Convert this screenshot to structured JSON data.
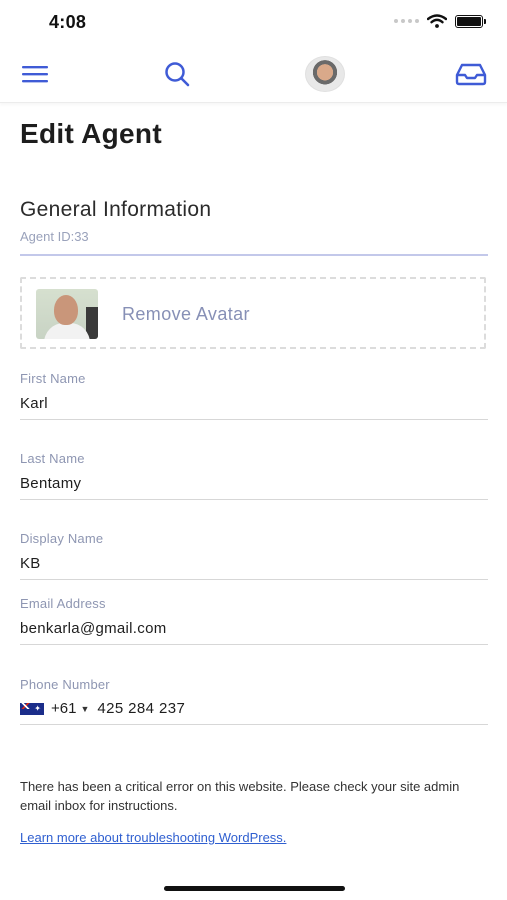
{
  "status_bar": {
    "time": "4:08"
  },
  "nav": {
    "menu_icon": "hamburger-menu-icon",
    "search_icon": "search-icon",
    "avatar_icon": "user-avatar",
    "inbox_icon": "inbox-icon",
    "accent_color": "#3f5bd6"
  },
  "page": {
    "title": "Edit Agent"
  },
  "section": {
    "title": "General Information",
    "agent_id": "Agent ID:33"
  },
  "avatar": {
    "remove_label": "Remove Avatar"
  },
  "fields": {
    "first_name": {
      "label": "First Name",
      "value": "Karl"
    },
    "last_name": {
      "label": "Last Name",
      "value": "Bentamy"
    },
    "display_name": {
      "label": "Display Name",
      "value": "KB"
    },
    "email": {
      "label": "Email Address",
      "value": "benkarla@gmail.com"
    },
    "phone": {
      "label": "Phone Number",
      "country_flag": "australia-flag",
      "country_code": "+61",
      "number": "425 284 237"
    }
  },
  "error": {
    "message": "There has been a critical error on this website. Please check your site admin email inbox for instructions.",
    "link_text": "Learn more about troubleshooting WordPress."
  }
}
